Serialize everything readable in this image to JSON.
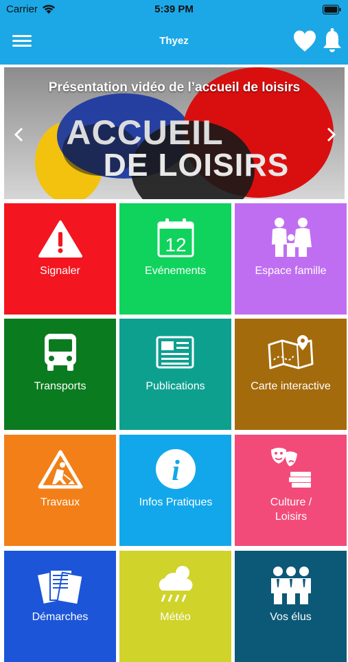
{
  "status_bar": {
    "carrier": "Carrier",
    "time": "5:39 PM"
  },
  "nav": {
    "title": "Thyez"
  },
  "banner": {
    "title": "Présentation vidéo de l’accueil de loisirs",
    "image_text_1": "ACCUEIL",
    "image_text_2": "DE LOISIRS"
  },
  "tiles": [
    {
      "label": "Signaler",
      "color": "#f3151f",
      "icon": "warning-icon"
    },
    {
      "label": "Evénements",
      "color": "#0fd35c",
      "icon": "calendar-icon",
      "icon_text": "12"
    },
    {
      "label": "Espace famille",
      "color": "#c06ef1",
      "icon": "family-icon"
    },
    {
      "label": "Transports",
      "color": "#0a7b1f",
      "icon": "bus-icon"
    },
    {
      "label": "Publications",
      "color": "#0ea08f",
      "icon": "newspaper-icon"
    },
    {
      "label": "Carte interactive",
      "color": "#a46b0c",
      "icon": "map-icon"
    },
    {
      "label": "Travaux",
      "color": "#f27f17",
      "icon": "roadwork-icon"
    },
    {
      "label": "Infos Pratiques",
      "color": "#12a7ea",
      "icon": "info-icon",
      "icon_text": "i"
    },
    {
      "label": "Culture / Loisirs",
      "color": "#f24b7a",
      "icon": "theater-icon"
    },
    {
      "label": "Démarches",
      "color": "#1c55d8",
      "icon": "documents-icon"
    },
    {
      "label": "Météo",
      "color": "#cfd32a",
      "icon": "weather-icon"
    },
    {
      "label": "Vos élus",
      "color": "#0c5877",
      "icon": "people-icon"
    }
  ]
}
